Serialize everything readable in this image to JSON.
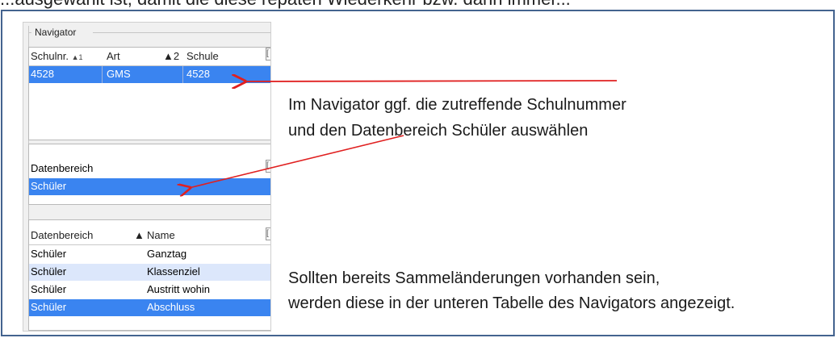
{
  "top_text": "...ausgewählt ist, damit die diese repaten Wiederkehr bzw. dann immer...",
  "navigator": {
    "title": "Navigator",
    "schools": {
      "headers": {
        "schulnr": "Schulnr.",
        "schulnr_sort": "▲1",
        "art": "Art",
        "art_sort": "▲2",
        "schule": "Schule"
      },
      "rows": [
        {
          "schulnr": "4528",
          "art": "GMS",
          "schule": "4528",
          "selected": true
        }
      ]
    },
    "datenbereich": {
      "header": "Datenbereich",
      "rows": [
        {
          "value": "Schüler",
          "selected": true
        }
      ]
    },
    "changes": {
      "headers": {
        "datenbereich": "Datenbereich",
        "sort": "▲",
        "name": "Name"
      },
      "rows": [
        {
          "datenbereich": "Schüler",
          "name": "Ganztag",
          "state": "normal"
        },
        {
          "datenbereich": "Schüler",
          "name": "Klassenziel",
          "state": "alt"
        },
        {
          "datenbereich": "Schüler",
          "name": "Austritt wohin",
          "state": "normal"
        },
        {
          "datenbereich": "Schüler",
          "name": "Abschluss",
          "state": "selected"
        }
      ]
    }
  },
  "annotations": {
    "upper_line1": "Im Navigator ggf. die zutreffende Schulnummer",
    "upper_line2": "und den Datenbereich Schüler auswählen",
    "lower_line1": "Sollten bereits Sammeländerungen vorhanden sein,",
    "lower_line2": "werden diese in der unteren Tabelle des Navigators angezeigt."
  },
  "colors": {
    "selection": "#3a84f0",
    "alt_row": "#dce7fb",
    "arrow": "#e02020",
    "frame": "#44638f"
  }
}
